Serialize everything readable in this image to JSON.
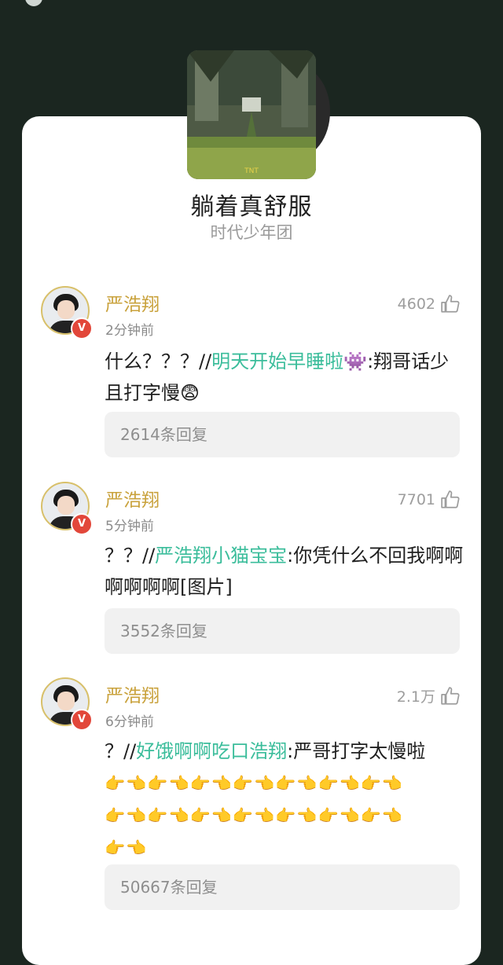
{
  "song": {
    "title": "躺着真舒服",
    "artist": "时代少年团"
  },
  "comments": [
    {
      "name": "严浩翔",
      "time": "2分钟前",
      "likes": "4602",
      "text_prefix": "什么？？？//",
      "mention": "明天开始早睡啦👾",
      "text_suffix": ":翔哥话少且打字慢😨",
      "replies": "2614条回复"
    },
    {
      "name": "严浩翔",
      "time": "5分钟前",
      "likes": "7701",
      "text_prefix": "？？//",
      "mention": "严浩翔小猫宝宝",
      "text_suffix": ":你凭什么不回我啊啊啊啊啊啊[图片]",
      "replies": "3552条回复"
    },
    {
      "name": "严浩翔",
      "time": "6分钟前",
      "likes": "2.1万",
      "text_prefix": "？//",
      "mention": "好饿啊啊吃口浩翔",
      "text_suffix": ":严哥打字太慢啦",
      "emoji_line1": "👉👈👉👈👉👈👉👈👉👈👉👈👉👈",
      "emoji_line2": "👉👈👉👈👉👈👉👈👉👈👉👈👉👈",
      "emoji_line3": "👉👈",
      "replies": "50667条回复"
    }
  ],
  "icons": {
    "like": "thumbs-up-icon",
    "verified": "v-badge"
  },
  "colors": {
    "background": "#1b2620",
    "name": "#c9a23c",
    "mention": "#3bbd9b",
    "badge": "#e2473a"
  }
}
